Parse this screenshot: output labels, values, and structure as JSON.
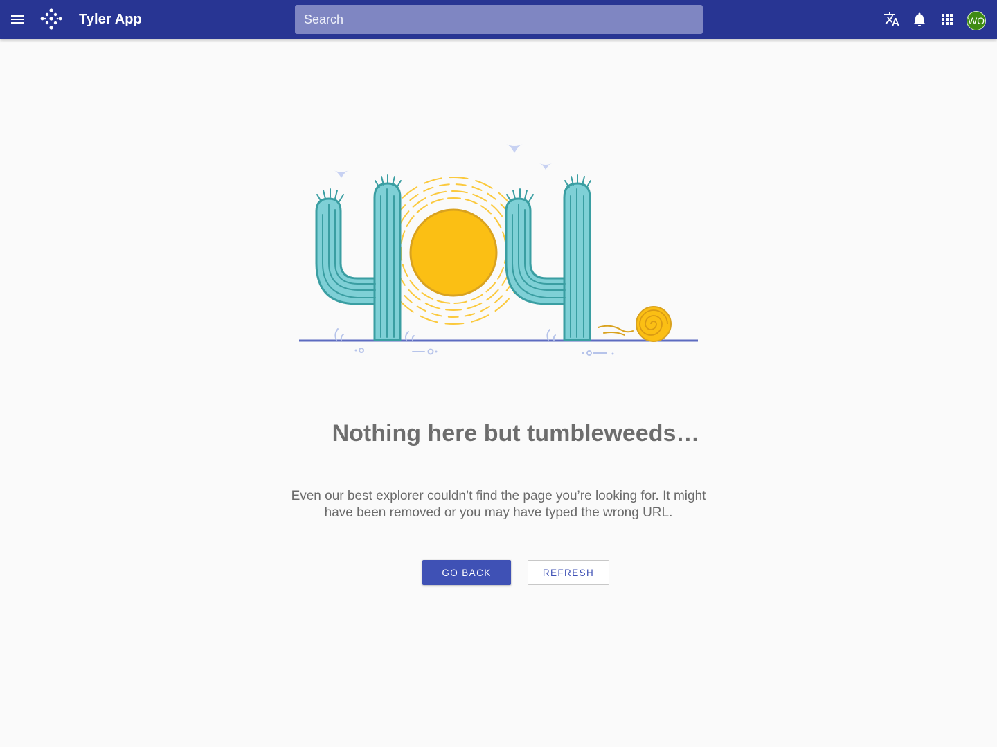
{
  "app": {
    "title": "Tyler App",
    "search_placeholder": "Search",
    "avatar_initials": "WO"
  },
  "icons": {
    "menu": "menu-icon",
    "logo": "tyler-logo-icon",
    "translate": "translate-icon",
    "notifications": "bell-icon",
    "apps": "apps-grid-icon"
  },
  "colors": {
    "appbar": "#283593",
    "primary": "#3f51b5",
    "avatar": "#3f8b12",
    "cactus": "#7fd0d6",
    "sun": "#fbbf14"
  },
  "error_page": {
    "heading": "Nothing here but tumbleweeds…",
    "message": "Even our best explorer couldn’t find the page you’re looking for. It might have been removed or you may have typed the wrong URL.",
    "go_back_label": "GO BACK",
    "refresh_label": "REFRESH"
  }
}
